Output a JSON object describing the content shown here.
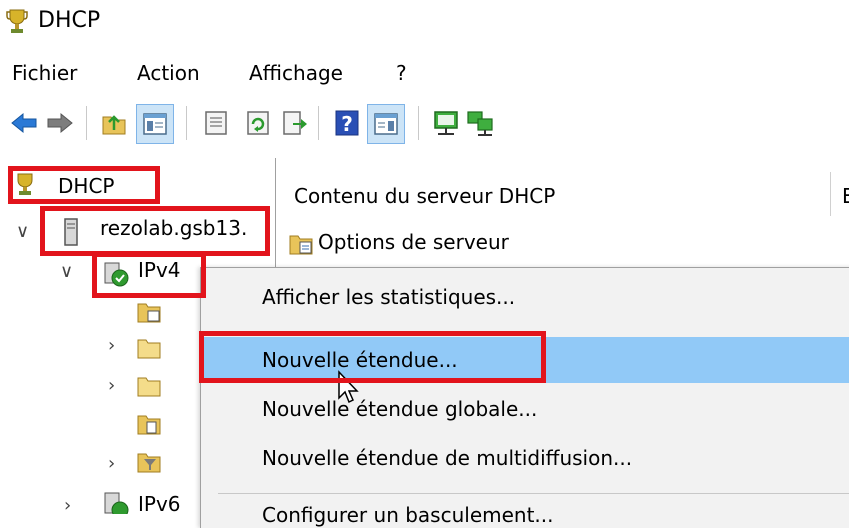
{
  "window": {
    "title": "DHCP",
    "icon": "dhcp-trophy-icon"
  },
  "menu": {
    "items": [
      "Fichier",
      "Action",
      "Affichage",
      "?"
    ]
  },
  "toolbar": {
    "buttons": [
      "back-arrow-icon",
      "forward-arrow-icon",
      "up-folder-icon",
      "show-hide-tree-icon",
      "properties-icon",
      "refresh-icon",
      "export-list-icon",
      "help-icon",
      "show-hide-action-pane-icon",
      "server-icon",
      "server-network-icon"
    ]
  },
  "tree": {
    "root": "DHCP",
    "server": "rezolab.gsb13.",
    "ipv4": "IPv4",
    "ipv6": "IPv6"
  },
  "right_pane": {
    "header": "Contenu du serveur DHCP",
    "server_options": "Options de serveur",
    "next_column_letter": "E"
  },
  "context_menu": {
    "items": [
      "Afficher les statistiques...",
      "Nouvelle étendue...",
      "Nouvelle étendue globale...",
      "Nouvelle étendue de multidiffusion...",
      "Configurer un basculement..."
    ],
    "highlighted_index": 1
  },
  "colors": {
    "highlight": "#91c9f7",
    "annotation_red": "#e2141c",
    "menu_bg": "#f2f2f2"
  }
}
